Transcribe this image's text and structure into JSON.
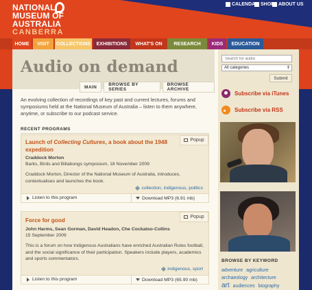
{
  "header": {
    "logo": [
      "NATIONAL",
      "MUSEUM OF",
      "AUSTRALIA",
      "CANBERRA"
    ],
    "utility": [
      {
        "label": "CALENDAR",
        "icon": "calendar-icon"
      },
      {
        "label": "SHOP",
        "icon": "shop-icon"
      },
      {
        "label": "ABOUT US",
        "icon": "info-icon"
      }
    ]
  },
  "nav": {
    "items": [
      {
        "label": "HOME",
        "color": "#e0451e"
      },
      {
        "label": "VISIT",
        "color": "#f2a33b"
      },
      {
        "label": "COLLECTIONS",
        "color": "#f7c66a"
      },
      {
        "label": "EXHIBITIONS",
        "color": "#8a2a3a"
      },
      {
        "label": "WHAT'S ON",
        "color": "#c2361a"
      },
      {
        "label": "RESEARCH",
        "color": "#7a8a3a"
      },
      {
        "label": "KIDS",
        "color": "#9a2a7a"
      },
      {
        "label": "EDUCATION",
        "color": "#2a5a9a"
      }
    ]
  },
  "main": {
    "title": "Audio on demand",
    "tabs": [
      "MAIN",
      "BROWSE BY SERIES",
      "BROWSE ARCHIVE"
    ],
    "intro": "An evolving collection of recordings of key past and current lectures, forums and symposiums held at the National Museum of Australia – listen to them anywhere, anytime, or subscribe to our podcast service.",
    "recent_heading": "RECENT PROGRAMS",
    "programs": [
      {
        "title_pre": "Launch of ",
        "title_em": "Collecting Cultures",
        "title_post": ", a book about the 1948",
        "title_line2": "expedition",
        "speakers": "Craddock Morton",
        "series": "Barks, Birds and Billabongs symposium",
        "date": ", 18 November 2009",
        "description": "Craddock Morton, Director of the National Museum of Australia, introduces, contextualises and launches the book.",
        "tags": "collection, indigenous, politics",
        "popup": "Popup",
        "listen": "Listen to this program",
        "download": "Download MP3 (6.91 mb)"
      },
      {
        "title": "Force for good",
        "speakers": "John Harms, Sean Gorman, David Headon, Che Cockatoo-Collins",
        "date": "15 September 2009",
        "description": "This is a forum on how Indigenous Australians have enriched Australian Rules football, and the social significance of their participation. Speakers include players, academics and sports commentators.",
        "tags": "indigenous, sport",
        "popup": "Popup",
        "listen": "Listen to this program",
        "download": "Download MP3 (65.90 mb)"
      }
    ]
  },
  "sidebar": {
    "search_placeholder": "Search for audio",
    "category": "All categories",
    "submit": "Submit",
    "itunes": "Subscribe via iTunes",
    "rss": "Subscribe via RSS",
    "keyword_heading": "BROWSE BY KEYWORD",
    "keywords_line1": [
      "adventure",
      "agriculture"
    ],
    "keywords_line2": [
      "archaeology",
      "architecture"
    ],
    "keywords_line3": [
      "art",
      "audiences",
      "biography"
    ]
  }
}
